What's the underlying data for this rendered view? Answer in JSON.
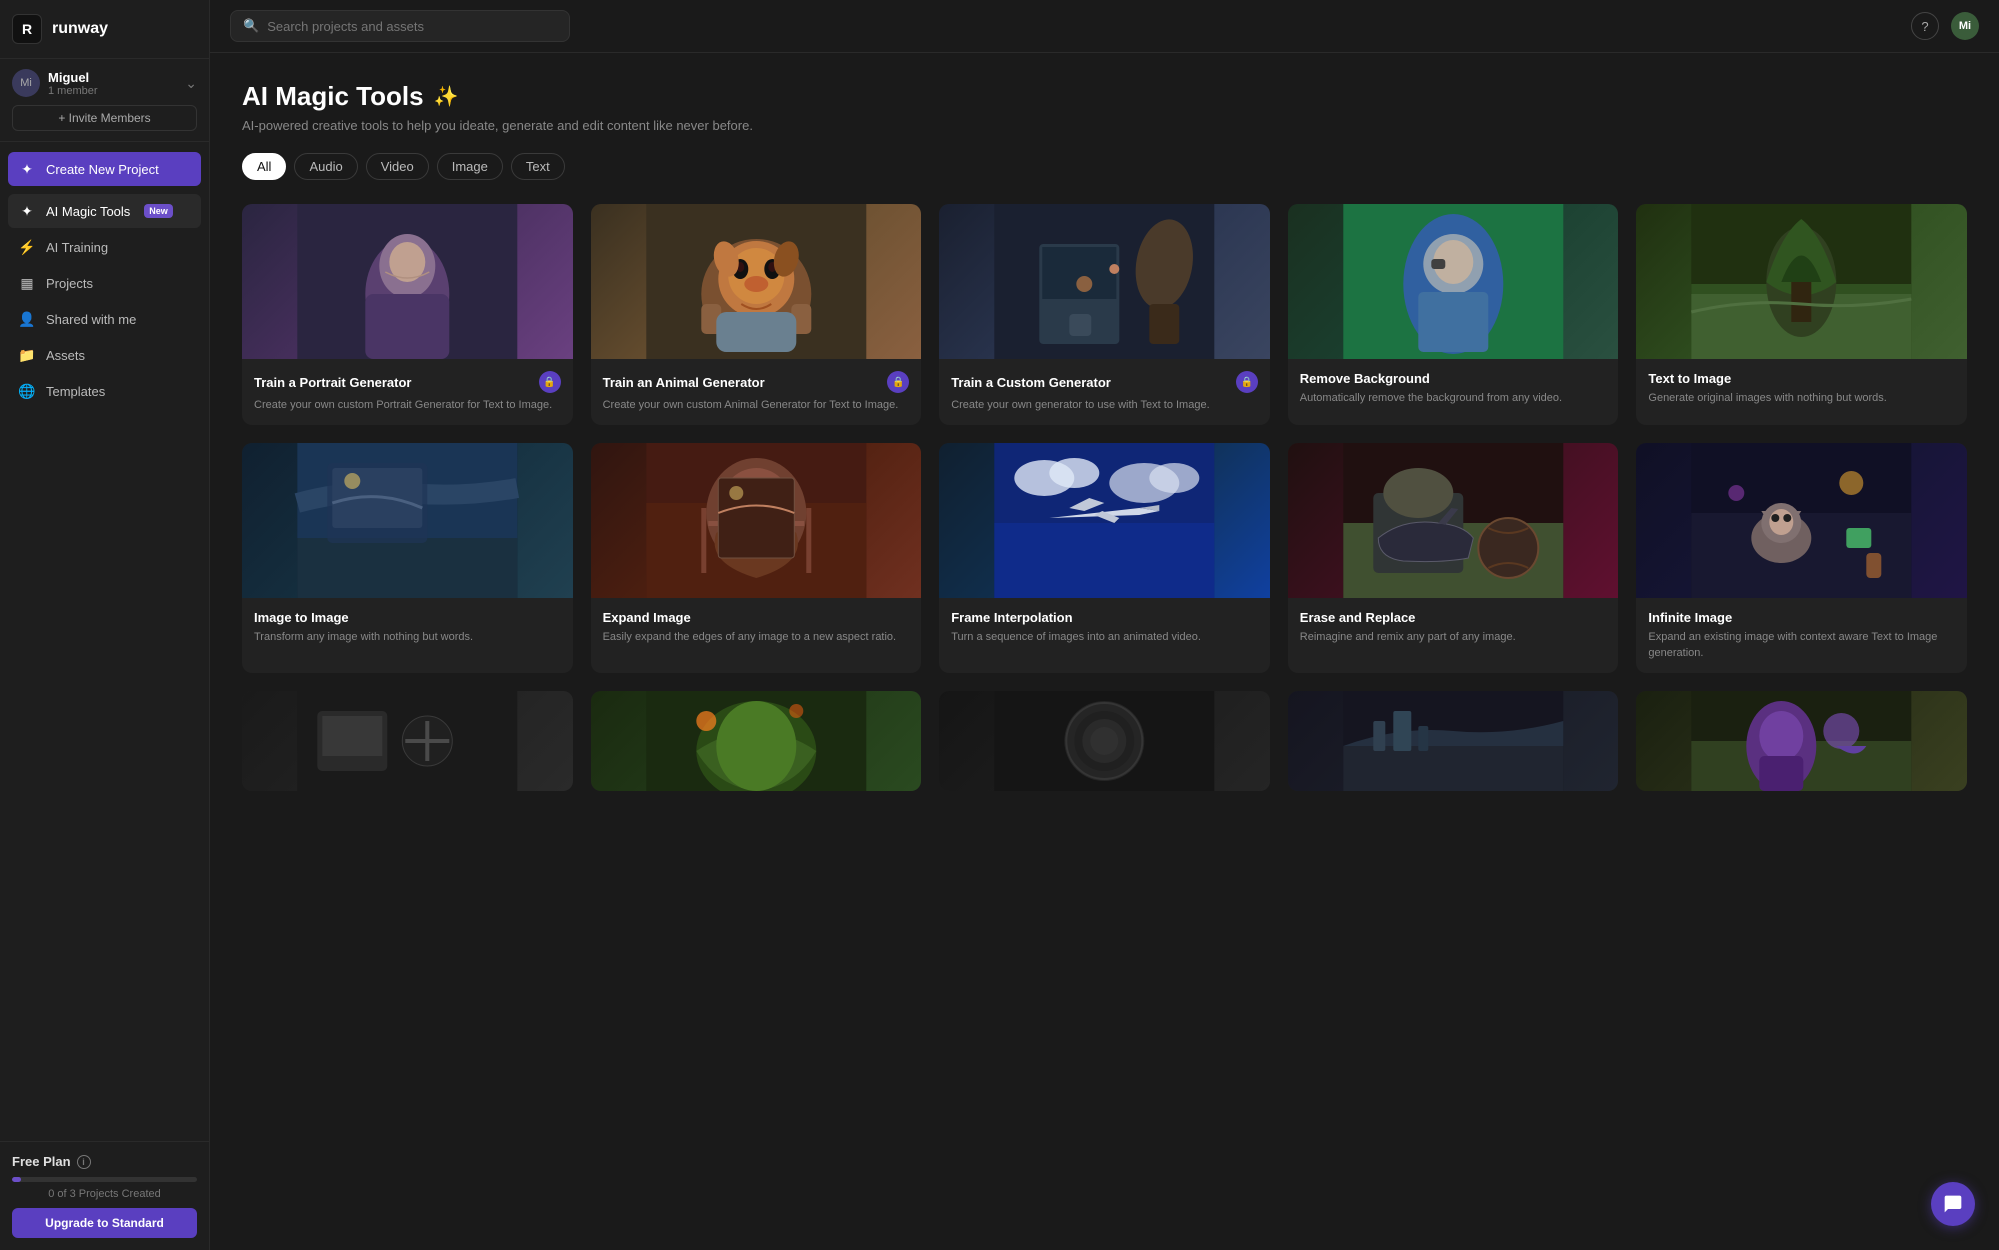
{
  "app": {
    "logo_symbol": "R",
    "logo_name": "runway"
  },
  "sidebar": {
    "workspace": {
      "avatar": "Mi",
      "name": "Miguel",
      "members": "1 member",
      "chevron": "⌃"
    },
    "invite_button": "+ Invite Members",
    "nav_items": [
      {
        "id": "create",
        "icon": "＋",
        "label": "Create New Project",
        "active": false,
        "badge": null
      },
      {
        "id": "ai-magic-tools",
        "icon": "✦",
        "label": "AI Magic Tools",
        "active": true,
        "badge": "New"
      },
      {
        "id": "ai-training",
        "icon": "⚡",
        "label": "AI Training",
        "active": false,
        "badge": null
      },
      {
        "id": "projects",
        "icon": "▦",
        "label": "Projects",
        "active": false,
        "badge": null
      },
      {
        "id": "shared",
        "icon": "👥",
        "label": "Shared with me",
        "active": false,
        "badge": null
      },
      {
        "id": "assets",
        "icon": "📁",
        "label": "Assets",
        "active": false,
        "badge": null
      },
      {
        "id": "templates",
        "icon": "🌐",
        "label": "Templates",
        "active": false,
        "badge": null
      }
    ],
    "footer": {
      "plan_label": "Free Plan",
      "projects_count": "0 of 3 Projects Created",
      "progress_percent": 5,
      "upgrade_button": "Upgrade to Standard"
    }
  },
  "topbar": {
    "search_placeholder": "Search projects and assets",
    "help_label": "?",
    "user_avatar": "Mi"
  },
  "main": {
    "title": "AI Magic Tools",
    "title_icon": "✨",
    "subtitle": "AI-powered creative tools to help you ideate, generate and edit content like never before.",
    "filter_tabs": [
      {
        "id": "all",
        "label": "All",
        "active": true
      },
      {
        "id": "audio",
        "label": "Audio",
        "active": false
      },
      {
        "id": "video",
        "label": "Video",
        "active": false
      },
      {
        "id": "image",
        "label": "Image",
        "active": false
      },
      {
        "id": "text",
        "label": "Text",
        "active": false
      }
    ],
    "tool_rows": [
      [
        {
          "id": "portrait-generator",
          "title": "Train a Portrait Generator",
          "description": "Create your own custom Portrait Generator for Text to Image.",
          "img_class": "img-portrait",
          "has_lock": true,
          "img_content": "portrait"
        },
        {
          "id": "animal-generator",
          "title": "Train an Animal Generator",
          "description": "Create your own custom Animal Generator for Text to Image.",
          "img_class": "img-dog",
          "has_lock": true,
          "img_content": "dog"
        },
        {
          "id": "custom-generator",
          "title": "Train a Custom Generator",
          "description": "Create your own generator to use with Text to Image.",
          "img_class": "img-custom",
          "has_lock": true,
          "img_content": "bottle"
        },
        {
          "id": "remove-background",
          "title": "Remove Background",
          "description": "Automatically remove the background from any video.",
          "img_class": "img-remove-bg",
          "has_lock": false,
          "img_content": "astronaut"
        },
        {
          "id": "text-to-image",
          "title": "Text to Image",
          "description": "Generate original images with nothing but words.",
          "img_class": "img-text-to-img",
          "has_lock": false,
          "img_content": "tree"
        }
      ],
      [
        {
          "id": "image-to-image",
          "title": "Image to Image",
          "description": "Transform any image with nothing but words.",
          "img_class": "img-img-to-img",
          "has_lock": false,
          "img_content": "paris"
        },
        {
          "id": "expand-image",
          "title": "Expand Image",
          "description": "Easily expand the edges of any image to a new aspect ratio.",
          "img_class": "img-expand",
          "has_lock": false,
          "img_content": "rock"
        },
        {
          "id": "frame-interpolation",
          "title": "Frame Interpolation",
          "description": "Turn a sequence of images into an animated video.",
          "img_class": "img-interpolation",
          "has_lock": false,
          "img_content": "plane"
        },
        {
          "id": "erase-replace",
          "title": "Erase and Replace",
          "description": "Reimagine and remix any part of any image.",
          "img_class": "img-erase",
          "has_lock": false,
          "img_content": "shoe"
        },
        {
          "id": "infinite-image",
          "title": "Infinite Image",
          "description": "Expand an existing image with context aware Text to Image generation.",
          "img_class": "img-infinite",
          "has_lock": false,
          "img_content": "cat"
        }
      ],
      [
        {
          "id": "row3-1",
          "title": "",
          "description": "",
          "img_class": "img-r1",
          "has_lock": false,
          "img_content": "chair"
        },
        {
          "id": "row3-2",
          "title": "",
          "description": "",
          "img_class": "img-r2",
          "has_lock": false,
          "img_content": "tree2"
        },
        {
          "id": "row3-3",
          "title": "",
          "description": "",
          "img_class": "img-r3",
          "has_lock": false,
          "img_content": "sphere"
        },
        {
          "id": "row3-4",
          "title": "",
          "description": "",
          "img_class": "img-r4",
          "has_lock": false,
          "img_content": "forest"
        },
        {
          "id": "row3-5",
          "title": "",
          "description": "",
          "img_class": "img-r5",
          "has_lock": false,
          "img_content": "character"
        }
      ]
    ]
  },
  "chat_fab": "💬"
}
